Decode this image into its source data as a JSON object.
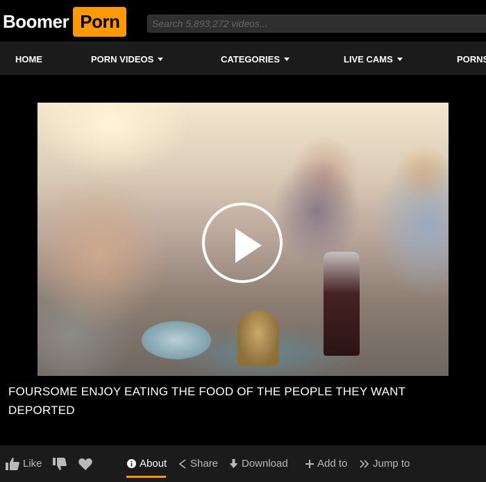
{
  "header": {
    "logo_left": "Boomer",
    "logo_right": "Porn",
    "search_placeholder": "Search 5,893,272 videos..."
  },
  "nav": {
    "items": [
      {
        "label": "HOME",
        "has_dropdown": false
      },
      {
        "label": "PORN VIDEOS",
        "has_dropdown": true
      },
      {
        "label": "CATEGORIES",
        "has_dropdown": true
      },
      {
        "label": "LIVE CAMS",
        "has_dropdown": true
      },
      {
        "label": "PORNS",
        "has_dropdown": false
      }
    ]
  },
  "video": {
    "title": "FOURSOME ENJOY EATING THE FOOD OF THE PEOPLE THEY WANT DEPORTED"
  },
  "actions": {
    "like_label": "Like",
    "about_label": "About",
    "share_label": "Share",
    "download_label": "Download",
    "add_to_label": "Add to",
    "jump_to_label": "Jump to"
  },
  "colors": {
    "accent": "#ff9900",
    "background": "#000000",
    "bar": "#1b1b1b"
  }
}
